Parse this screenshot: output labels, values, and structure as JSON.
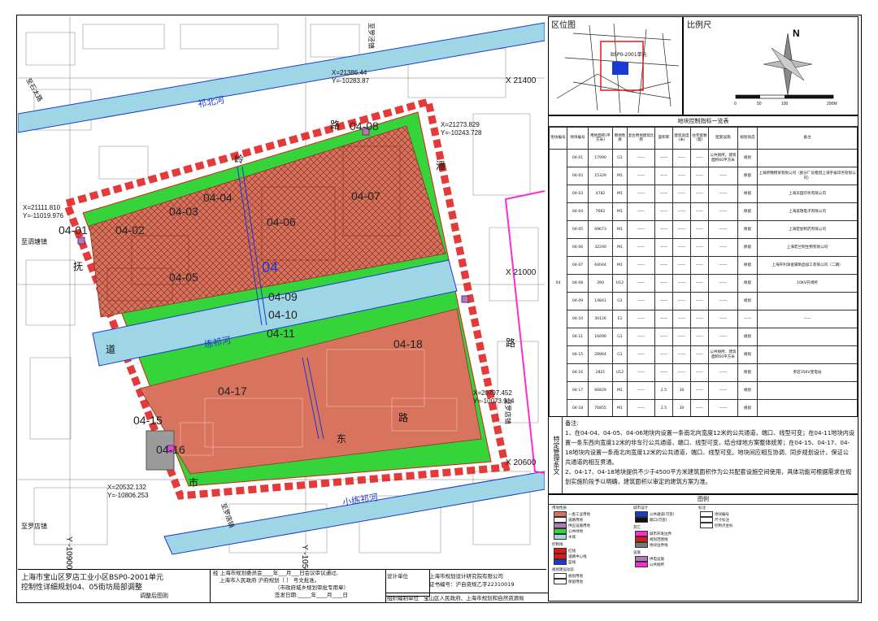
{
  "map": {
    "plot_labels": [
      "04-01",
      "04-02",
      "04-03",
      "04-04",
      "04-05",
      "04-06",
      "04-07",
      "04-08",
      "04-09",
      "04-10",
      "04-11",
      "04-17",
      "04-18",
      "04-15",
      "04-16"
    ],
    "block_number": "04",
    "rivers": {
      "north": "祁北河",
      "middle": "练祁河",
      "south": "小练祁河"
    },
    "roads": {
      "north_road": "路",
      "east_road_top": "潘",
      "east_road_bottom": "路",
      "west_road_top": "抚",
      "west_road_bottom": "道",
      "south_road_1": "东",
      "south_road_2": "路",
      "south_road_3": "市",
      "east_street": "至罗店镇",
      "southeast": "至罗店镇",
      "west": "至泗塘镇",
      "north": "至罗泾镇",
      "northwest": "至石太路",
      "southwest": "至罗店镇",
      "mid_road": "岭"
    },
    "axis_labels": {
      "x_21400": "X 21400",
      "x_21000": "X 21000",
      "x_20600": "X 20600",
      "y_10500": "Y -10500",
      "y_10900": "Y -10900"
    },
    "coords": [
      {
        "x": "X=21386.44",
        "y": "Y=-10283.87"
      },
      {
        "x": "X=21273.829",
        "y": "Y=-10243.728"
      },
      {
        "x": "X=21111.810",
        "y": "Y=-11019.976"
      },
      {
        "x": "X=20797.452",
        "y": "Y=-10073.914"
      },
      {
        "x": "X=20532.132",
        "y": "Y=-10806.253"
      }
    ]
  },
  "location": {
    "title": "区位图",
    "unit_label": "BSP0-2001单元"
  },
  "scale": {
    "title": "比例尺",
    "north": "N",
    "ticks": [
      "0",
      "50",
      "100",
      "200M"
    ]
  },
  "table": {
    "title": "地块控制指标一览表",
    "headers": [
      "街坊编号",
      "地块编号",
      "用地面积(平方米)",
      "用地性质",
      "混合用地建筑比例",
      "容积率",
      "建筑高度(米)",
      "住宅套数(套)",
      "配套设施",
      "规划动态",
      "备注"
    ],
    "block": "04",
    "rows": [
      [
        "04-01",
        "17990",
        "G1",
        "——",
        "——",
        "——",
        "——",
        "公共厕所，建筑面积60平方米",
        "规划",
        ""
      ],
      [
        "04-02",
        "15329",
        "M1",
        "——",
        "——",
        "——",
        "——",
        "——",
        "保留",
        "上海新锦物资有限公司（部分厂房租借上海宇泰印务有限公司）"
      ],
      [
        "04-03",
        "4782",
        "M1",
        "——",
        "——",
        "——",
        "——",
        "——",
        "保留",
        "上海天园印务有限公司"
      ],
      [
        "04-04",
        "7662",
        "M1",
        "——",
        "——",
        "——",
        "——",
        "——",
        "保留",
        "上海美瑞电子有限公司"
      ],
      [
        "04-05",
        "69673",
        "M1",
        "——",
        "——",
        "——",
        "——",
        "——",
        "保留",
        "上海宏星制药有限公司"
      ],
      [
        "04-06",
        "32290",
        "M1",
        "——",
        "——",
        "——",
        "——",
        "——",
        "保留",
        "上海宏兰制生物有限公司"
      ],
      [
        "04-07",
        "64044",
        "M1",
        "——",
        "——",
        "——",
        "——",
        "——",
        "保留",
        "上海开利泽金属制品加工有限公司（二期）"
      ],
      [
        "04-08",
        "390",
        "U12",
        "——",
        "——",
        "——",
        "——",
        "——",
        "保留",
        "10KV开闭所"
      ],
      [
        "04-09",
        "14841",
        "G1",
        "——",
        "——",
        "——",
        "——",
        "——",
        "规划",
        ""
      ],
      [
        "04-10",
        "30126",
        "E1",
        "——",
        "——",
        "——",
        "——",
        "——",
        "——",
        "——"
      ],
      [
        "04-11",
        "16099",
        "G1",
        "——",
        "——",
        "——",
        "——",
        "——",
        "规划",
        ""
      ],
      [
        "04-15",
        "28964",
        "G1",
        "——",
        "——",
        "——",
        "——",
        "公共厕所，建筑面积60平方米",
        "规划",
        ""
      ],
      [
        "04-16",
        "2821",
        "U12",
        "——",
        "——",
        "——",
        "——",
        "——",
        "保留",
        "罗店35KV变电站"
      ],
      [
        "04-17",
        "66829",
        "M1",
        "——",
        "2.5",
        "30",
        "——",
        "——",
        "规划",
        ""
      ],
      [
        "04-18",
        "76855",
        "M1",
        "——",
        "2.5",
        "30",
        "——",
        "——",
        "规划",
        ""
      ]
    ]
  },
  "special": {
    "title": "特定管理条文",
    "heading": "备注:",
    "items": [
      "1、在04-04、04-05、04-06地块内设置一条南北向宽度12米的公共通道，端口、线型可变；在04-11地块内设置一条东西向宽度12米的非车行公共通道，端口、线型可变，结合绿地方案整体统筹；在04-15、04-17、04-18地块内设置一条南北向宽度12米的公共通道，端口、线型可变。地块间应相互协调、同步规划设计，保证公共通道的相互贯通。",
      "2、04-17、04-18地块提供不少于4500平方米建筑面积作为公共配套设施空间使用，具体功能可根据需求在规划实施阶段予以明确，建筑面积以审定的建筑方案为准。"
    ]
  },
  "legend": {
    "title": "图例",
    "land_use_title": "用地性质",
    "land_use": [
      "一类工业用地",
      "道路用地",
      "供应设施用地",
      "公共绿地",
      "水域"
    ],
    "urban_design_title": "城市设计",
    "urban_design": [
      "公共通道(可变)",
      "端口(可变)"
    ],
    "marks_title": "标注",
    "marks": [
      "地块编号",
      "尺寸标注",
      "控制点坐标"
    ],
    "control_title": "控制线",
    "control": [
      "红线",
      "道路中心线",
      "蓝线"
    ],
    "other_title": "其它",
    "other": [
      "城市开发边界",
      "规划范围线",
      "地块边界线"
    ],
    "facilities_title": "设施",
    "facilities": [
      "供电设施",
      "公共厕所"
    ],
    "plan_title": "规划建设动态",
    "plan": [
      "规划用地",
      "保留用地"
    ],
    "colors": {
      "industrial": "#d8735e",
      "road": "#ffffff",
      "utility": "#b07ab6",
      "green": "#35d43a",
      "water": "#9fd6e6",
      "redline": "#e01818",
      "blue": "#1a3ad0",
      "pink": "#ff2bd6"
    }
  },
  "footer": {
    "title_line1": "上海市宝山区罗店工业小区BSP0-2001单元",
    "title_line2": "控制性详细规划04、05街坊局部调整",
    "subtitle": "调整后图则",
    "approval_1": "经  上海市规划委员会____年___月___日会议审议通过,",
    "approval_2": "上海市人民政府    沪府规划〔       〕     号文批准。",
    "approval_3": "（市政府城乡规划审批专用章）",
    "approval_4": "签发日期:_____年____月____日",
    "design_label": "设计单位",
    "design_unit": "上海市规划设计研究院有限公司",
    "cert": "证书编号：沪自资规乙字22310019",
    "org_label": "组织编制单位",
    "org_unit": "宝山区人民政府、上海市规划和自然资源局"
  }
}
